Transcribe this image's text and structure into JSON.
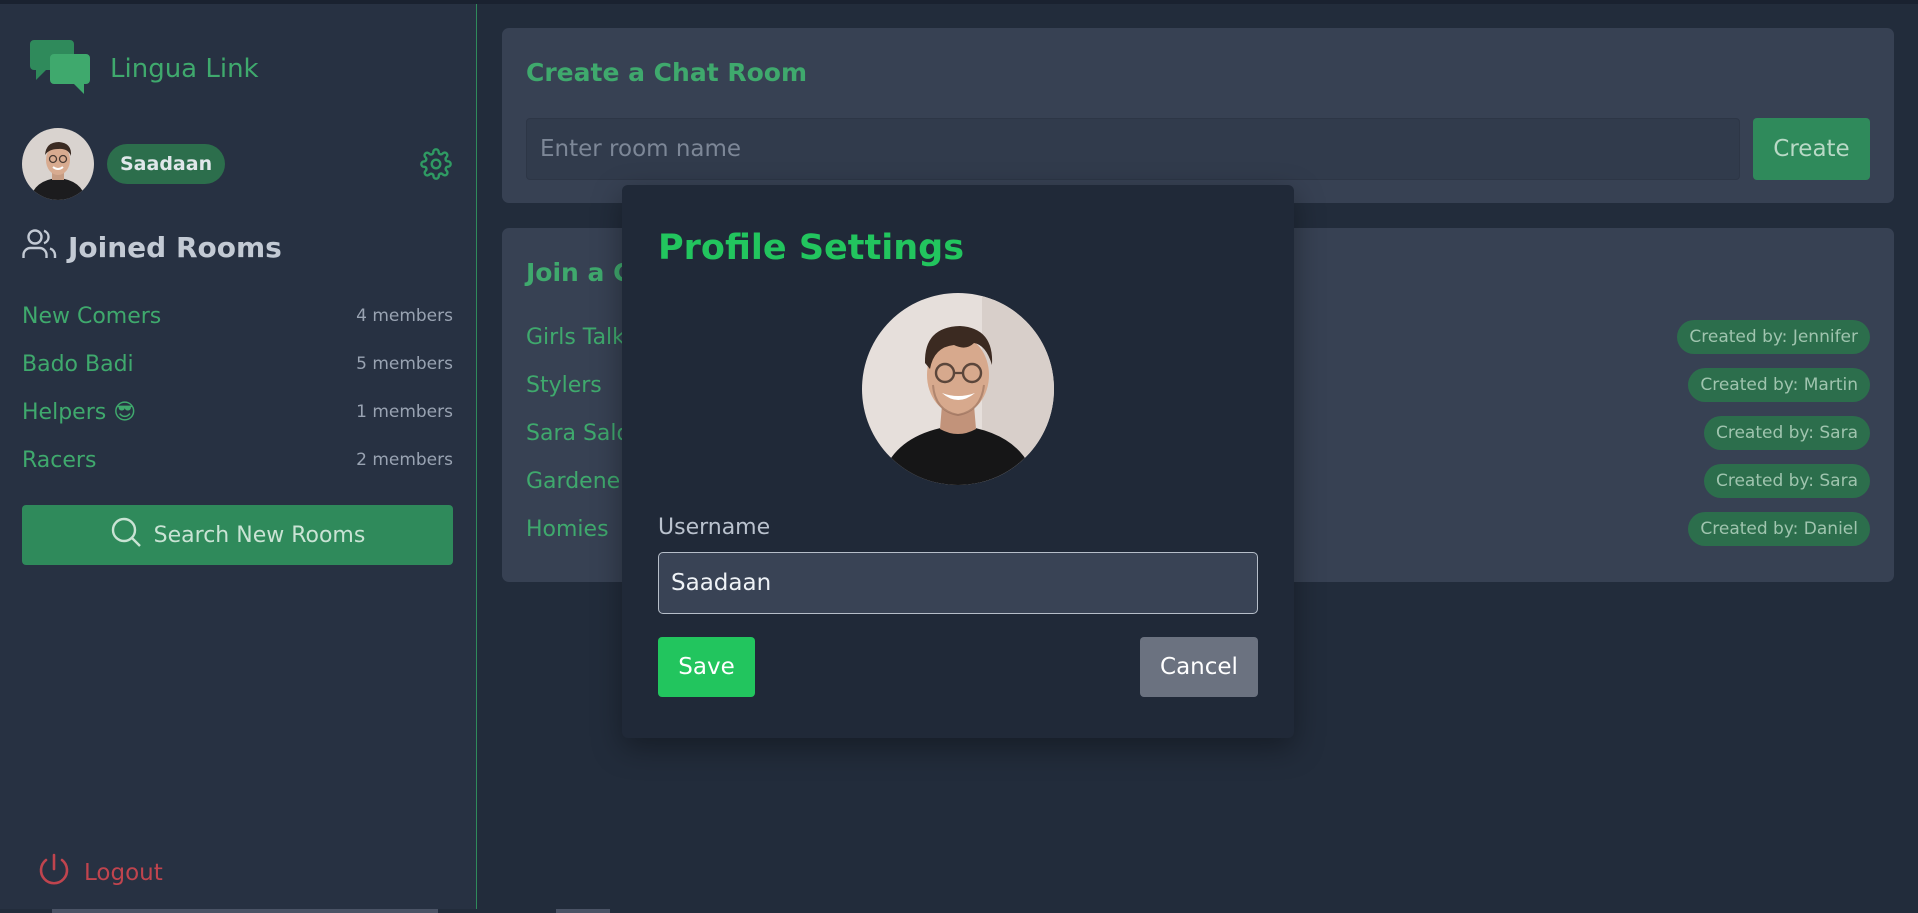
{
  "app": {
    "name": "Lingua Link",
    "logo_icon": "chat-bubbles-icon",
    "accent": "#3fa96d"
  },
  "user": {
    "name": "Saadaan",
    "settings_icon": "gear-icon"
  },
  "sidebar": {
    "joined_title": "Joined Rooms",
    "joined_icon": "users-icon",
    "rooms": [
      {
        "name": "New Comers",
        "members": "4 members"
      },
      {
        "name": "Bado Badi",
        "members": "5 members"
      },
      {
        "name": "Helpers 😎",
        "members": "1 members"
      },
      {
        "name": "Racers",
        "members": "2 members"
      }
    ],
    "search_label": "Search New Rooms",
    "search_icon": "search-icon",
    "logout_label": "Logout",
    "logout_icon": "power-icon"
  },
  "create_room": {
    "title": "Create a Chat Room",
    "placeholder": "Enter room name",
    "button": "Create"
  },
  "join_room": {
    "title": "Join a Chat Room",
    "rooms": [
      {
        "name": "Girls Talk",
        "created_by": "Created by: Jennifer"
      },
      {
        "name": "Stylers",
        "created_by": "Created by: Martin"
      },
      {
        "name": "Sara Salon",
        "created_by": "Created by: Sara"
      },
      {
        "name": "Gardeners",
        "created_by": "Created by: Sara"
      },
      {
        "name": "Homies",
        "created_by": "Created by: Daniel"
      }
    ]
  },
  "modal": {
    "title": "Profile Settings",
    "username_label": "Username",
    "username_value": "Saadaan",
    "save": "Save",
    "cancel": "Cancel",
    "save_color": "#22c55e",
    "cancel_color": "#6b7280"
  }
}
